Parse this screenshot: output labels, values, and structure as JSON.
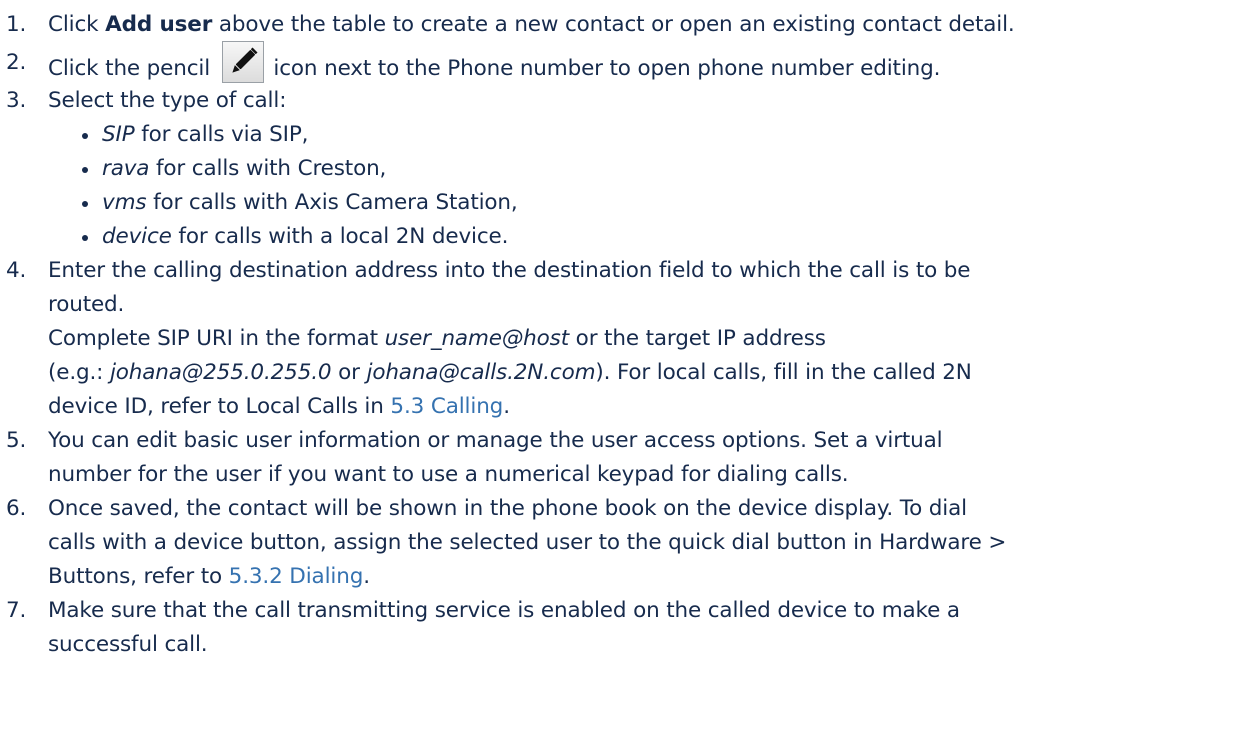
{
  "steps": [
    {
      "number": "1.",
      "prefix": "Click ",
      "bold": "Add user",
      "suffix": " above the table to create a new contact or open an existing contact detail."
    },
    {
      "number": "2.",
      "prefix": "Click the pencil ",
      "icon": "pencil-edit-icon",
      "suffix": " icon next to the Phone number to open phone number editing."
    },
    {
      "number": "3.",
      "text": "Select the type of call:",
      "bullets": [
        {
          "term": "SIP",
          "rest": " for calls via SIP,"
        },
        {
          "term": "rava",
          "rest": " for calls with Creston,"
        },
        {
          "term": "vms",
          "rest": " for calls with Axis Camera Station,"
        },
        {
          "term": "device",
          "rest": " for calls with a local 2N device."
        }
      ]
    },
    {
      "number": "4.",
      "line1": "Enter the calling destination address into the destination field to which the call is to be",
      "line2": "routed.",
      "line3_prefix": "Complete SIP URI in the format ",
      "line3_format": "user_name@host",
      "line3_suffix": " or the target IP address",
      "line4_prefix": "(e.g.: ",
      "example1": "johana@255.0.255.0",
      "or": " or ",
      "example2": "johana@calls.2N.com",
      "line4_suffix": "). For local calls, fill in the called 2N",
      "line5_prefix": "device ID, refer to Local Calls in ",
      "link": "5.3 Calling",
      "line5_suffix": "."
    },
    {
      "number": "5.",
      "line1": "You can edit basic user information or manage the user access options. Set a virtual",
      "line2": "number for the user if you want to use a numerical keypad for dialing calls."
    },
    {
      "number": "6.",
      "line1": "Once saved, the contact will be shown in the phone book on the device display. To dial",
      "line2": "calls with a device button, assign the selected user to the quick dial button in Hardware >",
      "line3_prefix": "Buttons, refer to ",
      "link": "5.3.2 Dialing",
      "line3_suffix": "."
    },
    {
      "number": "7.",
      "line1": "Make sure that the call transmitting service is enabled on the called device to make a",
      "line2": "successful call."
    }
  ],
  "colors": {
    "text": "#172b4d",
    "link": "#3572b0"
  }
}
